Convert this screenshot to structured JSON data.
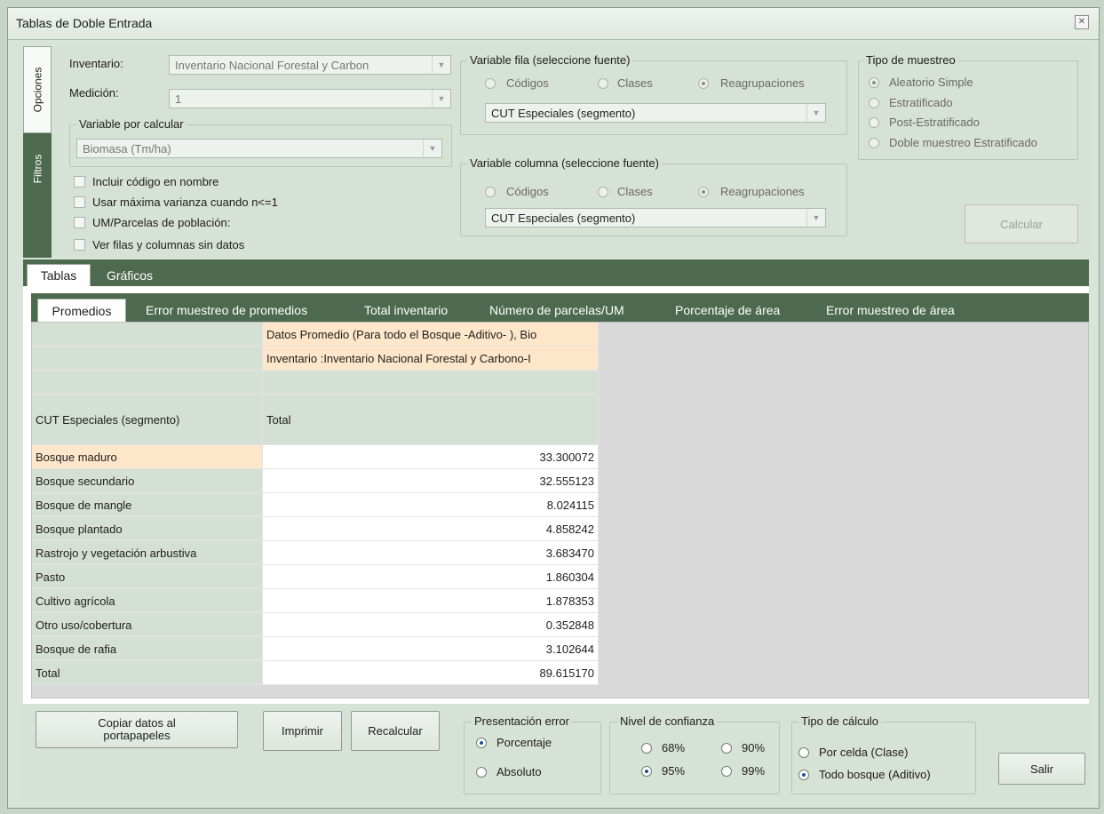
{
  "window": {
    "title": "Tablas de Doble Entrada"
  },
  "side_tabs": [
    "Opciones",
    "Filtros"
  ],
  "options": {
    "inventario_label": "Inventario:",
    "inventario_value": "Inventario Nacional Forestal y Carbon",
    "medicion_label": "Medición:",
    "medicion_value": "1",
    "variable_calcular": {
      "title": "Variable por calcular",
      "value": "Biomasa (Tm/ha)"
    },
    "checkboxes": [
      "Incluir código en nombre",
      "Usar máxima varianza cuando n<=1",
      "UM/Parcelas de población:",
      "Ver filas y columnas sin datos"
    ]
  },
  "variable_fila": {
    "title": "Variable fila (seleccione fuente)",
    "options": [
      "Códigos",
      "Clases",
      "Reagrupaciones"
    ],
    "selected": "Reagrupaciones",
    "combo_value": "CUT Especiales (segmento)"
  },
  "variable_columna": {
    "title": "Variable columna (seleccione fuente)",
    "options": [
      "Códigos",
      "Clases",
      "Reagrupaciones"
    ],
    "selected": "Reagrupaciones",
    "combo_value": "CUT Especiales (segmento)"
  },
  "tipo_muestreo": {
    "title": "Tipo de muestreo",
    "options": [
      "Aleatorio Simple",
      "Estratificado",
      "Post-Estratificado",
      "Doble muestreo Estratificado"
    ],
    "selected": "Aleatorio Simple"
  },
  "calcular_label": "Calcular",
  "main_tabs": [
    "Tablas",
    "Gráficos"
  ],
  "sub_tabs": [
    "Promedios",
    "Error muestreo de promedios",
    "Total inventario",
    "Número de parcelas/UM",
    "Porcentaje de área",
    "Error muestreo de área"
  ],
  "table": {
    "header_line1": "Datos Promedio (Para todo el Bosque -Aditivo- ), Bio",
    "header_line2": "Inventario :Inventario Nacional Forestal y Carbono-I",
    "row_header": "CUT Especiales (segmento)",
    "col_header": "Total",
    "rows": [
      {
        "label": "Bosque maduro",
        "value": "33.300072"
      },
      {
        "label": "Bosque secundario",
        "value": "32.555123"
      },
      {
        "label": "Bosque de mangle",
        "value": "8.024115"
      },
      {
        "label": "Bosque plantado",
        "value": "4.858242"
      },
      {
        "label": "Rastrojo y vegetación arbustiva",
        "value": "3.683470"
      },
      {
        "label": "Pasto",
        "value": "1.860304"
      },
      {
        "label": "Cultivo agrícola",
        "value": "1.878353"
      },
      {
        "label": "Otro uso/cobertura",
        "value": "0.352848"
      },
      {
        "label": "Bosque de rafia",
        "value": "3.102644"
      },
      {
        "label": "Total",
        "value": "89.615170"
      }
    ]
  },
  "bottom": {
    "copiar_line1": "Copiar  datos al",
    "copiar_line2": "portapapeles",
    "imprimir": "Imprimir",
    "recalcular": "Recalcular",
    "presentacion": {
      "title": "Presentación error",
      "options": [
        "Porcentaje",
        "Absoluto"
      ],
      "selected": "Porcentaje"
    },
    "confianza": {
      "title": "Nivel de confianza",
      "options": [
        "68%",
        "90%",
        "95%",
        "99%"
      ],
      "selected": "95%"
    },
    "calculo": {
      "title": "Tipo de cálculo",
      "options": [
        "Por celda (Clase)",
        "Todo bosque (Aditivo)"
      ],
      "selected": "Todo bosque (Aditivo)"
    },
    "salir": "Salir"
  }
}
